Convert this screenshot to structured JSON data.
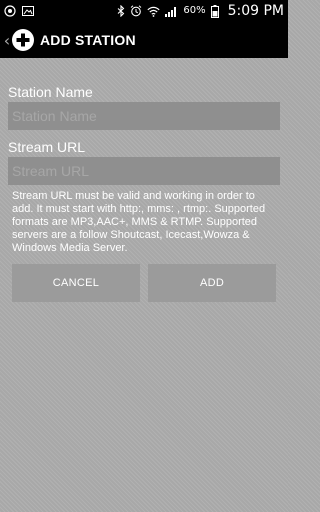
{
  "status_bar": {
    "battery_percent": "60%",
    "time": "5:09 PM"
  },
  "action_bar": {
    "title": "ADD STATION"
  },
  "form": {
    "station_name_label": "Station Name",
    "station_name_placeholder": "Station Name",
    "stream_url_label": "Stream  URL",
    "stream_url_placeholder": "Stream URL",
    "help_text": "Stream URL must be valid and working in order to add. It must start with http:, mms: , rtmp:. Supported formats are MP3,AAC+, MMS & RTMP. Supported servers are a follow Shoutcast, Icecast,Wowza & Windows Media Server."
  },
  "buttons": {
    "cancel_label": "CANCEL",
    "add_label": "ADD"
  }
}
